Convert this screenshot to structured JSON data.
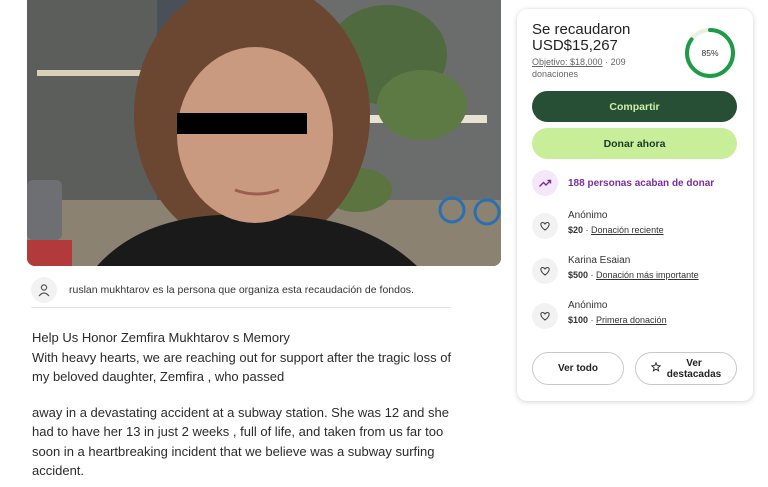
{
  "organizer": {
    "text": "ruslan mukhtarov es la persona que organiza esta recaudación de fondos."
  },
  "story": {
    "title": "Help Us Honor Zemfira Mukhtarov s Memory",
    "paragraph1": "With heavy hearts, we are reaching out for support after the tragic loss of my beloved daughter, Zemfira , who passed",
    "paragraph2": "away in a devastating accident at a subway station. She was 12 and she had to have her 13 in just 2 weeks , full of life, and taken from us far too soon in a heartbreaking incident that we believe was a subway surfing accident."
  },
  "summary": {
    "raised_label": "Se recaudaron",
    "raised_amount": "USD$15,267",
    "goal": "Objetivo: $18,000",
    "separator": "·",
    "donations_count": "209",
    "donations_label": "donaciones",
    "progress_text": "85%",
    "progress_fraction": 0.85
  },
  "actions": {
    "share_label": "Compartir",
    "donate_label": "Donar ahora"
  },
  "trend": {
    "text": "188 personas acaban de donar"
  },
  "donors": [
    {
      "name": "Anónimo",
      "amount": "$20",
      "sep": " · ",
      "tag": "Donación reciente"
    },
    {
      "name": "Karina Esaian",
      "amount": "$500",
      "sep": " · ",
      "tag": "Donación más importante"
    },
    {
      "name": "Anónimo",
      "amount": "$100",
      "sep": " · ",
      "tag": "Primera donación"
    }
  ],
  "footer": {
    "see_all_label": "Ver todo",
    "top_label_line1": "Ver",
    "top_label_line2": "destacadas"
  },
  "colors": {
    "brand_dark": "#264f36",
    "brand_light": "#c8ee9a",
    "progress": "#1e9b47",
    "trend_purple": "#7a2e9c"
  },
  "icons": {
    "organizer": "user-icon",
    "trend": "trending-up-icon",
    "donor": "heart-hand-icon",
    "top": "star-icon"
  }
}
